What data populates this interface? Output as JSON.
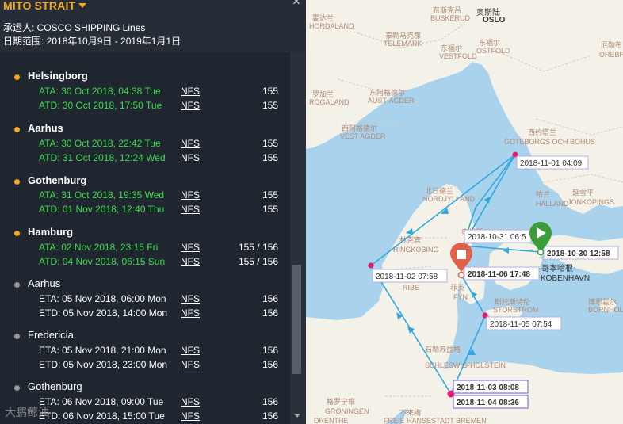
{
  "header": {
    "vessel_name": "MITO STRAIT",
    "carrier": "承运人: COSCO SHIPPING Lines",
    "date_range": "日期范围: 2018年10月9日 - 2019年1月1日"
  },
  "ports": [
    {
      "name": "Helsingborg",
      "status": "done",
      "events": [
        {
          "text": "ATA: 30 Oct 2018, 04:38 Tue",
          "link": "NFS",
          "qty": "155",
          "kind": "actual"
        },
        {
          "text": "ATD: 30 Oct 2018, 17:50 Tue",
          "link": "NFS",
          "qty": "155",
          "kind": "actual"
        }
      ]
    },
    {
      "name": "Aarhus",
      "status": "done",
      "events": [
        {
          "text": "ATA: 30 Oct 2018, 22:42 Tue",
          "link": "NFS",
          "qty": "155",
          "kind": "actual"
        },
        {
          "text": "ATD: 31 Oct 2018, 12:24 Wed",
          "link": "NFS",
          "qty": "155",
          "kind": "actual"
        }
      ]
    },
    {
      "name": "Gothenburg",
      "status": "done",
      "events": [
        {
          "text": "ATA: 31 Oct 2018, 19:35 Wed",
          "link": "NFS",
          "qty": "155",
          "kind": "actual"
        },
        {
          "text": "ATD: 01 Nov 2018, 12:40 Thu",
          "link": "NFS",
          "qty": "155",
          "kind": "actual"
        }
      ]
    },
    {
      "name": "Hamburg",
      "status": "done",
      "events": [
        {
          "text": "ATA: 02 Nov 2018, 23:15 Fri",
          "link": "NFS",
          "qty": "155 / 156",
          "kind": "actual"
        },
        {
          "text": "ATD: 04 Nov 2018, 06:15 Sun",
          "link": "NFS",
          "qty": "155 / 156",
          "kind": "actual"
        }
      ]
    },
    {
      "name": "Aarhus",
      "status": "future",
      "events": [
        {
          "text": "ETA: 05 Nov 2018, 06:00 Mon",
          "link": "NFS",
          "qty": "156",
          "kind": "estimate"
        },
        {
          "text": "ETD: 05 Nov 2018, 14:00 Mon",
          "link": "NFS",
          "qty": "156",
          "kind": "estimate"
        }
      ]
    },
    {
      "name": "Fredericia",
      "status": "future",
      "events": [
        {
          "text": "ETA: 05 Nov 2018, 21:00 Mon",
          "link": "NFS",
          "qty": "156",
          "kind": "estimate"
        },
        {
          "text": "ETD: 05 Nov 2018, 23:00 Mon",
          "link": "NFS",
          "qty": "156",
          "kind": "estimate"
        }
      ]
    },
    {
      "name": "Gothenburg",
      "status": "future",
      "events": [
        {
          "text": "ETA: 06 Nov 2018, 09:00 Tue",
          "link": "NFS",
          "qty": "156",
          "kind": "estimate"
        },
        {
          "text": "ETD: 06 Nov 2018, 15:00 Tue",
          "link": "NFS",
          "qty": "156",
          "kind": "estimate"
        }
      ]
    }
  ],
  "watermark": "大鹏鲸油",
  "map": {
    "places": {
      "oslo_cn": "奥斯陆",
      "oslo": "OSLO",
      "hordaland_cn": "霍达兰",
      "hordaland": "HORDALAND",
      "buskerud_cn": "布斯克吕",
      "buskerud": "BUSKERUD",
      "telemark_cn": "泰勒马克郡",
      "telemark": "TELEMARK",
      "vestfold_cn": "东福尔",
      "vestfold": "VESTFOLD",
      "ostfold_cn": "东福尔",
      "ostfold": "OSTFOLD",
      "orebro_cn": "厄勒布",
      "orebro": "OREBRO",
      "rogaland_cn": "罗加兰",
      "rogaland": "ROGALAND",
      "aust_agder_cn": "东阿格德尔",
      "aust_agder": "AUST-AGDER",
      "vest_agder_cn": "西阿格德尔",
      "vest_agder": "VEST AGDER",
      "gotaland_cn": "西约塔兰",
      "gotaland": "GOTEBORGS OCH BOHUS",
      "nordjylland_cn": "北日德兰",
      "nordjylland": "NORDJYLLAND",
      "halland_cn": "哈兰",
      "halland": "HALLAND",
      "jonkoping_cn": "延雪平",
      "jonkoping": "JONKOPINGS",
      "aarhus_cn": "奥胡斯",
      "aarhus": "ARH",
      "ringkobing_cn": "林克宾",
      "ringkobing": "RINGKOBING",
      "ribe": "RIBE",
      "fyn_cn": "菲英",
      "fyn": "FYN",
      "storstrom_cn": "斯托斯特伦",
      "storstrom": "STORSTROM",
      "kobenhavn_cn": "哥本哈根",
      "kobenhavn": "KOBENHAVN",
      "bornholm_cn": "博恩霍尔",
      "bornholm": "BORNHOLM",
      "schleswig_cn": "石勒苏益格",
      "schleswig": "SCHLESWIG-HOLSTEIN",
      "groningen_cn": "格罗宁根",
      "groningen": "GRONINGEN",
      "bremen_cn": "不来梅",
      "bremen": "FREIE HANSESTADT BREMEN",
      "drenthe": "DRENTHE"
    },
    "timestamps": {
      "t1": "2018-11-01 04:09",
      "t2": "2018-10-31 06:5",
      "t3": "2018-10-30 12:58",
      "t4": "2018-11-02 07:58",
      "t5": "2018-11-06 17:48",
      "t6": "2018-11-05 07:54",
      "t7": "2018-11-03 08:08",
      "t8": "2018-11-04 08:36"
    },
    "colors": {
      "route": "#2fa9e0",
      "waypoint": "#e8196b",
      "start_pin": "#3a9d3a",
      "end_pin": "#e0604a",
      "sea": "#a9d3ec",
      "land": "#f4f1e9"
    }
  }
}
